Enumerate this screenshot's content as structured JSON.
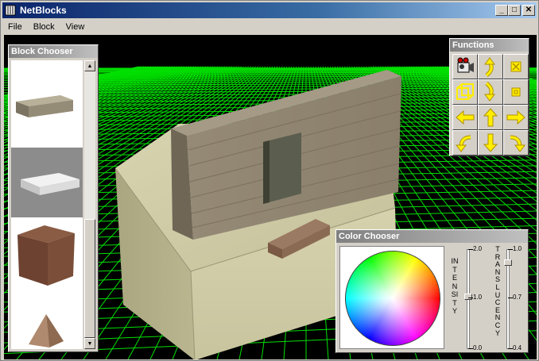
{
  "window": {
    "title": "NetBlocks"
  },
  "menu": {
    "items": [
      "File",
      "Block",
      "View"
    ]
  },
  "block_chooser": {
    "title": "Block Chooser"
  },
  "functions": {
    "title": "Functions"
  },
  "color_chooser": {
    "title": "Color Chooser",
    "intensity": {
      "label": "INTENSITY",
      "max": "2.0",
      "mid": "1.0",
      "min": "0.0"
    },
    "translucency": {
      "label": "TRANSLUCENCY",
      "max": "1.0",
      "mid": "0.7",
      "min": "0.4"
    }
  },
  "colors": {
    "grid": "#00ff00",
    "icon_yellow": "#ffee00",
    "title_active": "#0a246a"
  }
}
